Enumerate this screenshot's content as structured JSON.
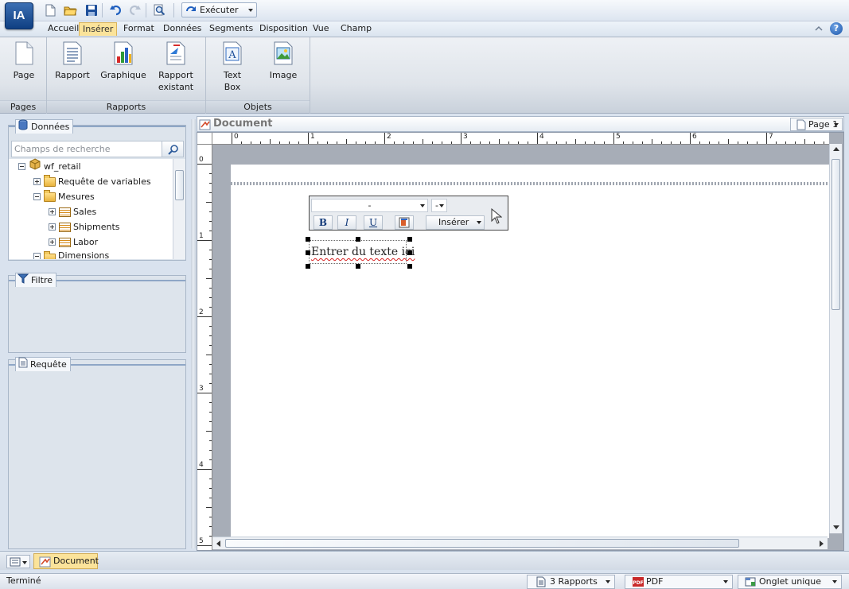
{
  "app": {
    "logo_text": "IA"
  },
  "quick_access": {
    "run_label": "Exécuter"
  },
  "menu": {
    "tabs": [
      {
        "label": "Accueil"
      },
      {
        "label": "Insérer"
      },
      {
        "label": "Format"
      },
      {
        "label": "Données"
      },
      {
        "label": "Segments"
      },
      {
        "label": "Disposition"
      },
      {
        "label": "Vue"
      },
      {
        "label": "Champ"
      }
    ],
    "active_tab": "Insérer",
    "help_label": "?"
  },
  "ribbon": {
    "groups": [
      {
        "label": "Pages",
        "buttons": [
          {
            "label": "Page"
          }
        ]
      },
      {
        "label": "Rapports",
        "buttons": [
          {
            "label": "Rapport"
          },
          {
            "label": "Graphique"
          },
          {
            "label": "Rapport existant"
          }
        ]
      },
      {
        "label": "Objets",
        "buttons": [
          {
            "label": "Text Box"
          },
          {
            "label": "Image"
          }
        ]
      }
    ]
  },
  "data_panel": {
    "title": "Données",
    "search_placeholder": "Champs de recherche",
    "tree": [
      {
        "label": "wf_retail"
      },
      {
        "label": "Requête de variables"
      },
      {
        "label": "Mesures"
      },
      {
        "label": "Sales"
      },
      {
        "label": "Shipments"
      },
      {
        "label": "Labor"
      },
      {
        "label": "Dimensions"
      }
    ]
  },
  "filter_panel": {
    "title": "Filtre"
  },
  "query_panel": {
    "title": "Requête"
  },
  "document": {
    "title": "Document",
    "page_label": "Page 1",
    "ruler_h": [
      "0",
      "1",
      "2",
      "3",
      "4",
      "5",
      "6",
      "7"
    ],
    "ruler_v": [
      "0",
      "1",
      "2",
      "3",
      "4",
      "5"
    ],
    "toolbar": {
      "font_value": "-",
      "size_value": "-",
      "bold_label": "B",
      "italic_label": "I",
      "underline_label": "U",
      "insert_label": "Insérer"
    },
    "textbox_text": "Entrer du texte ici"
  },
  "bottom_tabs": {
    "document_tab": "Document"
  },
  "status": {
    "text": "Terminé",
    "reports": "3 Rapports",
    "format": "PDF",
    "mode": "Onglet unique"
  }
}
